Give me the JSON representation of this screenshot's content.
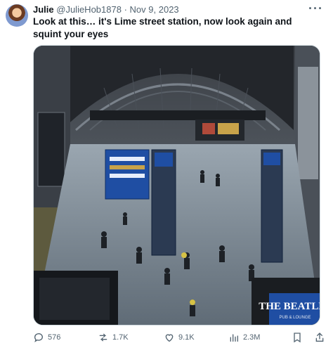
{
  "post": {
    "display_name": "Julie",
    "handle": "@JulieHob1878",
    "separator": "·",
    "date": "Nov 9, 2023",
    "text": "Look at this… it's Lime street station, now look again and squint your eyes",
    "more_icon": "more-horizontal-icon"
  },
  "image": {
    "sign_text": "THE BEATLES",
    "sign_subtext": "PUB & LOUNGE",
    "dominant_colors": [
      "#2a3038",
      "#8c9aa6",
      "#1f4ea3",
      "#c8a34a"
    ]
  },
  "actions": {
    "replies": "576",
    "reposts": "1.7K",
    "likes": "9.1K",
    "views": "2.3M"
  }
}
